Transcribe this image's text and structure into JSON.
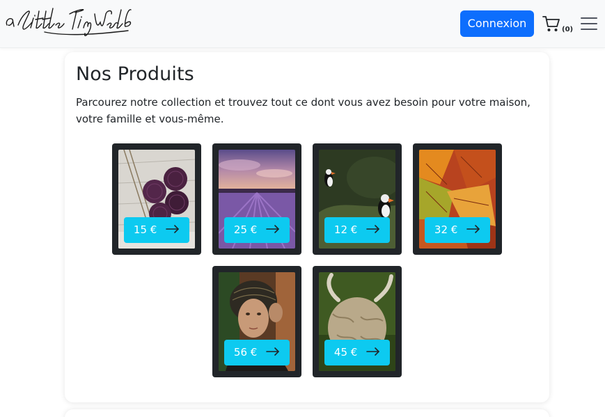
{
  "header": {
    "logo_text": "a Little Tiny World",
    "login_label": "Connexion",
    "cart_count": "(0)",
    "cart_icon": "cart-icon",
    "menu_icon": "hamburger-menu-icon"
  },
  "main": {
    "title": "Nos Produits",
    "description": "Parcourez notre collection et trouvez tout ce dont vous avez besoin pour votre maison, votre famille et vous-même."
  },
  "products": [
    {
      "price": "15 €",
      "image": "purple yarn balls on wooden table"
    },
    {
      "price": "25 €",
      "image": "lavender field at sunset"
    },
    {
      "price": "12 €",
      "image": "puffins on mossy cliff"
    },
    {
      "price": "32 €",
      "image": "orange autumn leaves"
    },
    {
      "price": "56 €",
      "image": "portrait of a woman with patterned headscarf"
    },
    {
      "price": "45 €",
      "image": "highland cow with horns"
    }
  ],
  "colors": {
    "primary": "#0d6efd",
    "info": "#0dcaf0",
    "card_dark": "#212529",
    "navbar_bg": "#f8f9fa"
  }
}
